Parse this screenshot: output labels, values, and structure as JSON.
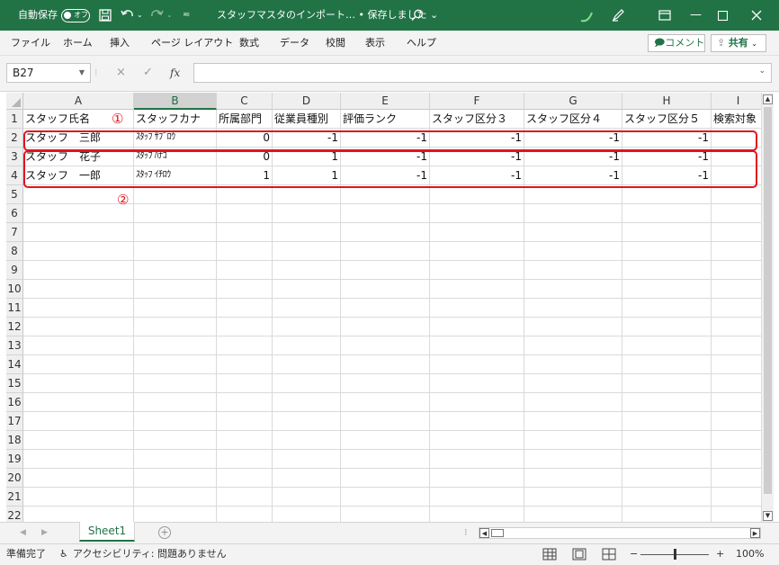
{
  "titlebar": {
    "autosave_label": "自動保存",
    "autosave_state": "オフ",
    "doc_title": "スタッフマスタのインポート… • 保存しました ⌄",
    "colors": {
      "bg": "#217346"
    }
  },
  "menu": {
    "items": [
      "ファイル",
      "ホーム",
      "挿入",
      "ページ レイアウト",
      "数式",
      "データ",
      "校閲",
      "表示",
      "ヘルプ"
    ],
    "comment_label": "コメント",
    "share_label": "共有"
  },
  "formula": {
    "cell_ref": "B27",
    "cancel_icon": "×",
    "enter_icon": "✓",
    "fx_label": "fx",
    "content": ""
  },
  "grid": {
    "selected_column": "B",
    "columns": [
      "A",
      "B",
      "C",
      "D",
      "E",
      "F",
      "G",
      "H",
      "I"
    ],
    "row_numbers": [
      "1",
      "2",
      "3",
      "4",
      "5",
      "6",
      "7",
      "8",
      "9",
      "10",
      "11",
      "12",
      "13",
      "14",
      "15",
      "16",
      "17",
      "18",
      "19",
      "20",
      "21",
      "22"
    ],
    "header": [
      "スタッフ氏名",
      "スタッフカナ",
      "所属部門",
      "従業員種別",
      "評価ランク",
      "スタッフ区分３",
      "スタッフ区分４",
      "スタッフ区分５",
      "検索対象"
    ],
    "rows": [
      [
        "スタッフ　三郎",
        "ｽﾀｯﾌ ｻﾌﾞﾛｳ",
        "0",
        "-1",
        "-1",
        "-1",
        "-1",
        "-1",
        ""
      ],
      [
        "スタッフ　花子",
        "ｽﾀｯﾌ ﾊﾅｺ",
        "0",
        "1",
        "-1",
        "-1",
        "-1",
        "-1",
        ""
      ],
      [
        "スタッフ　一郎",
        "ｽﾀｯﾌ ｲﾁﾛｳ",
        "1",
        "1",
        "-1",
        "-1",
        "-1",
        "-1",
        ""
      ]
    ]
  },
  "annotations": {
    "mark1": "①",
    "mark2": "②",
    "color": "#e0141e"
  },
  "sheets": {
    "active": "Sheet1",
    "add_icon": "+"
  },
  "status": {
    "ready": "準備完了",
    "accessibility": "アクセシビリティ: 問題ありません",
    "zoom": "100%",
    "zoom_minus": "−",
    "zoom_plus": "+"
  }
}
